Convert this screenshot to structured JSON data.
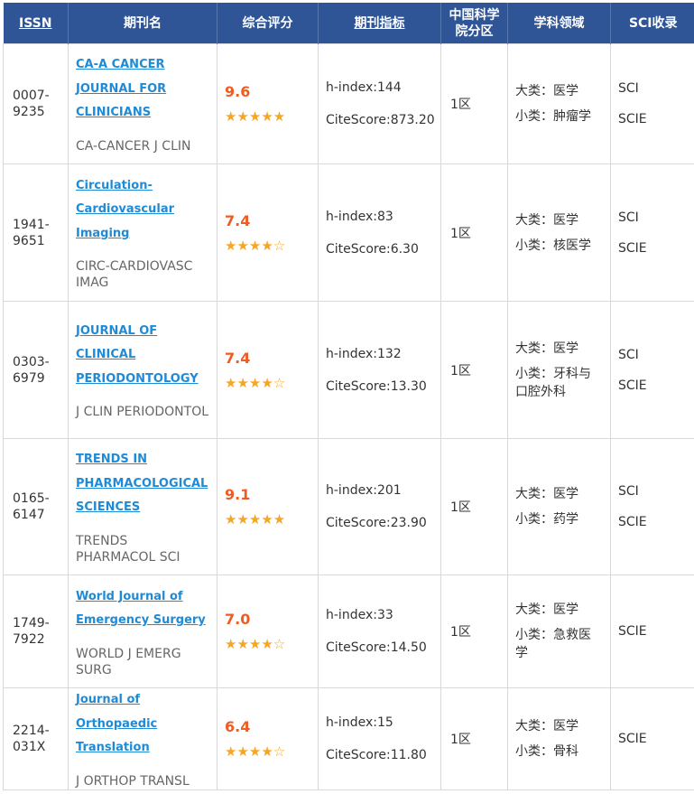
{
  "headers": {
    "issn": "ISSN",
    "name": "期刊名",
    "score": "综合评分",
    "metrics": "期刊指标",
    "zone_line1": "中国科学",
    "zone_line2": "院分区",
    "field": "学科领域",
    "sci": "SCI收录"
  },
  "rows": [
    {
      "issn1": "0007-",
      "issn2": "9235",
      "name_lines": [
        "CA-A CANCER",
        "JOURNAL FOR",
        "CLINICIANS"
      ],
      "abbr": "CA-CANCER J CLIN",
      "score": "9.6",
      "stars": "★★★★★",
      "h": "h-index:144",
      "cite": "CiteScore:873.20",
      "zone": "1区",
      "big": "大类：医学",
      "small": "小类：肿瘤学",
      "sci": [
        "SCI",
        "SCIE"
      ]
    },
    {
      "issn1": "1941-",
      "issn2": "9651",
      "name_lines": [
        "Circulation-",
        "Cardiovascular",
        "Imaging"
      ],
      "abbr": "CIRC-CARDIOVASC IMAG",
      "score": "7.4",
      "stars": "★★★★☆",
      "h": "h-index:83",
      "cite": "CiteScore:6.30",
      "zone": "1区",
      "big": "大类：医学",
      "small": "小类：核医学",
      "sci": [
        "SCI",
        "SCIE"
      ]
    },
    {
      "issn1": "0303-",
      "issn2": "6979",
      "name_lines": [
        "JOURNAL OF",
        "CLINICAL",
        "PERIODONTOLOGY"
      ],
      "abbr": "J CLIN PERIODONTOL",
      "score": "7.4",
      "stars": "★★★★☆",
      "h": "h-index:132",
      "cite": "CiteScore:13.30",
      "zone": "1区",
      "big": "大类：医学",
      "small": "小类：牙科与口腔外科",
      "sci": [
        "SCI",
        "SCIE"
      ]
    },
    {
      "issn1": "0165-",
      "issn2": "6147",
      "name_lines": [
        "TRENDS IN",
        "PHARMACOLOGICAL",
        "SCIENCES"
      ],
      "abbr": "TRENDS PHARMACOL SCI",
      "score": "9.1",
      "stars": "★★★★★",
      "h": "h-index:201",
      "cite": "CiteScore:23.90",
      "zone": "1区",
      "big": "大类：医学",
      "small": "小类：药学",
      "sci": [
        "SCI",
        "SCIE"
      ]
    },
    {
      "issn1": "1749-",
      "issn2": "7922",
      "name_lines": [
        "World Journal of",
        "Emergency Surgery"
      ],
      "abbr": "WORLD J EMERG SURG",
      "score": "7.0",
      "stars": "★★★★☆",
      "h": "h-index:33",
      "cite": "CiteScore:14.50",
      "zone": "1区",
      "big": "大类：医学",
      "small": "小类：急救医学",
      "sci": [
        "SCIE"
      ]
    },
    {
      "issn1": "2214-",
      "issn2": "031X",
      "name_lines": [
        "Journal of Orthopaedic",
        "Translation"
      ],
      "abbr": "J ORTHOP TRANSL",
      "score": "6.4",
      "stars": "★★★★☆",
      "h": "h-index:15",
      "cite": "CiteScore:11.80",
      "zone": "1区",
      "big": "大类：医学",
      "small": "小类：骨科",
      "sci": [
        "SCIE"
      ]
    }
  ]
}
